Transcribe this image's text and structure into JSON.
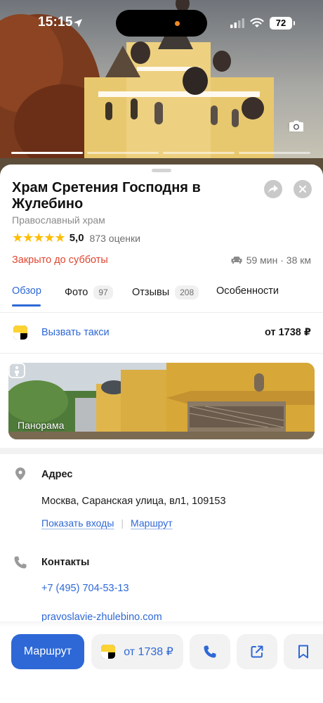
{
  "status_bar": {
    "time": "15:15",
    "battery": "72"
  },
  "hero": {
    "photo_count": "97"
  },
  "place": {
    "title": "Храм Сретения Господня в Жулебино",
    "category": "Православный храм",
    "stars": "★★★★★",
    "rating": "5,0",
    "rating_count": "873 оценки",
    "hours_status": "Закрыто до субботы",
    "route_time": "59 мин · 38 км"
  },
  "tabs": [
    {
      "label": "Обзор",
      "badge": ""
    },
    {
      "label": "Фото",
      "badge": "97"
    },
    {
      "label": "Отзывы",
      "badge": "208"
    },
    {
      "label": "Особенности",
      "badge": ""
    }
  ],
  "taxi": {
    "label": "Вызвать такси",
    "price": "от 1738 ₽"
  },
  "panorama": {
    "label": "Панорама"
  },
  "address": {
    "title": "Адрес",
    "value": "Москва, Саранская улица, вл1, 109153",
    "show_entrances": "Показать входы",
    "route": "Маршрут"
  },
  "contacts": {
    "title": "Контакты",
    "phone": "+7 (495) 704-53-13",
    "website": "pravoslavie-zhulebino.com"
  },
  "actions": {
    "route_label": "Маршрут",
    "taxi_price": "от 1738 ₽"
  },
  "colors": {
    "accent": "#2e68d6",
    "closed": "#e0452f",
    "star": "#fdbe06"
  }
}
